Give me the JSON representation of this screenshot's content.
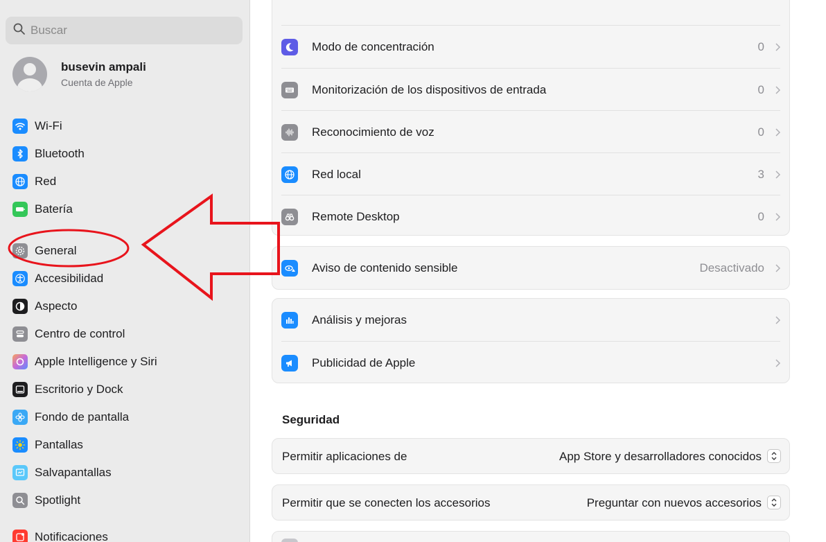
{
  "search": {
    "placeholder": "Buscar"
  },
  "account": {
    "name": "busevin ampali",
    "subtitle": "Cuenta de Apple"
  },
  "sidebar": {
    "items": [
      {
        "label": "Wi-Fi",
        "icon": "wifi-icon",
        "color": "#1a8cff"
      },
      {
        "label": "Bluetooth",
        "icon": "bluetooth-icon",
        "color": "#1a8cff"
      },
      {
        "label": "Red",
        "icon": "globe-icon",
        "color": "#1a8cff"
      },
      {
        "label": "Batería",
        "icon": "battery-icon",
        "color": "#34c759"
      },
      {
        "label": "General",
        "icon": "gear-icon",
        "color": "#8e8e93"
      },
      {
        "label": "Accesibilidad",
        "icon": "accessibility-icon",
        "color": "#1a8cff"
      },
      {
        "label": "Aspecto",
        "icon": "appearance-icon",
        "color": "#1d1d1f"
      },
      {
        "label": "Centro de control",
        "icon": "control-center-icon",
        "color": "#8e8e93"
      },
      {
        "label": "Apple Intelligence y Siri",
        "icon": "siri-icon",
        "color": "#c76ad8"
      },
      {
        "label": "Escritorio y Dock",
        "icon": "dock-icon",
        "color": "#1d1d1f"
      },
      {
        "label": "Fondo de pantalla",
        "icon": "wallpaper-icon",
        "color": "#3aa8f5"
      },
      {
        "label": "Pantallas",
        "icon": "sun-icon",
        "color": "#1a8cff"
      },
      {
        "label": "Salvapantallas",
        "icon": "screensaver-icon",
        "color": "#5ac8fa"
      },
      {
        "label": "Spotlight",
        "icon": "search-icon",
        "color": "#8e8e93"
      },
      {
        "label": "Notificaciones",
        "icon": "notifications-icon",
        "color": "#ff3b30"
      }
    ]
  },
  "main": {
    "group1": [
      {
        "label": "Modo de concentración",
        "value": "0",
        "icon": "moon-icon",
        "color": "#5e5ce6"
      },
      {
        "label": "Monitorización de los dispositivos de entrada",
        "value": "0",
        "icon": "keyboard-icon",
        "color": "#8e8e93"
      },
      {
        "label": "Reconocimiento de voz",
        "value": "0",
        "icon": "waveform-icon",
        "color": "#8e8e93"
      },
      {
        "label": "Red local",
        "value": "3",
        "icon": "globe-icon",
        "color": "#1a8cff"
      },
      {
        "label": "Remote Desktop",
        "value": "0",
        "icon": "binoculars-icon",
        "color": "#8e8e93"
      }
    ],
    "group2": [
      {
        "label": "Aviso de contenido sensible",
        "value": "Desactivado",
        "icon": "eye-warning-icon",
        "color": "#1a8cff"
      }
    ],
    "group3": [
      {
        "label": "Análisis y mejoras",
        "value": "",
        "icon": "chart-icon",
        "color": "#1a8cff"
      },
      {
        "label": "Publicidad de Apple",
        "value": "",
        "icon": "megaphone-icon",
        "color": "#1a8cff"
      }
    ],
    "security": {
      "title": "Seguridad",
      "rows": [
        {
          "label": "Permitir aplicaciones de",
          "value": "App Store y desarrolladores conocidos"
        },
        {
          "label": "Permitir que se conecten los accesorios",
          "value": "Preguntar con nuevos accesorios"
        }
      ]
    }
  },
  "annotation": {
    "color": "#e8141c"
  }
}
